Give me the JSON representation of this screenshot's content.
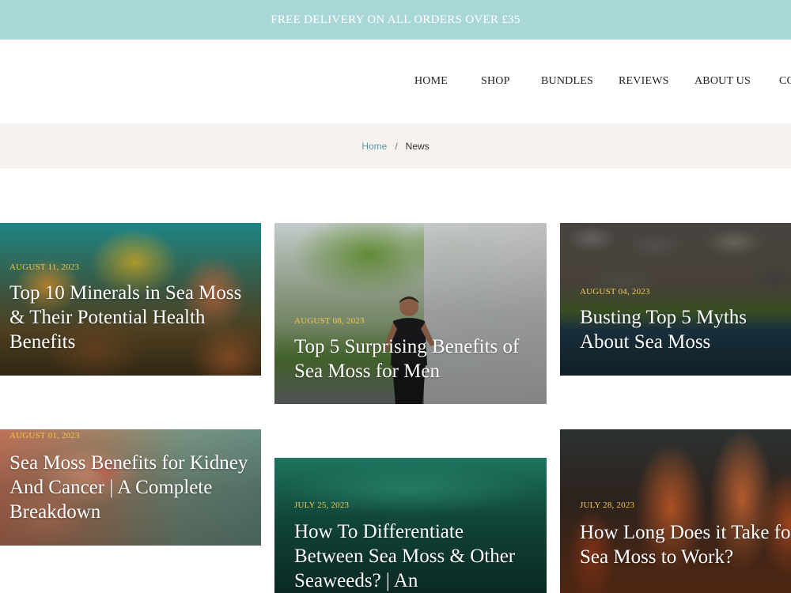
{
  "announcement": {
    "text": "FREE DELIVERY ON ALL ORDERS OVER £35"
  },
  "nav": {
    "items": [
      {
        "label": "HOME"
      },
      {
        "label": "SHOP"
      },
      {
        "label": "BUNDLES"
      },
      {
        "label": "REVIEWS"
      },
      {
        "label": "ABOUT US"
      },
      {
        "label": "CO"
      }
    ]
  },
  "breadcrumb": {
    "home": "Home",
    "separator": "/",
    "current": "News"
  },
  "articles": [
    {
      "date": "AUGUST 11, 2023",
      "title": "Top 10 Minerals in Sea Moss & Their Potential Health Benefits"
    },
    {
      "date": "AUGUST 08, 2023",
      "title": "Top 5 Surprising Benefits of Sea Moss for Men"
    },
    {
      "date": "AUGUST 04, 2023",
      "title": "Busting Top 5 Myths About Sea Moss"
    },
    {
      "date": "AUGUST 01, 2023",
      "title": "Sea Moss Benefits for Kidney And Cancer | A Complete Breakdown"
    },
    {
      "date": "JULY 25, 2023",
      "title": "How To Differentiate Between Sea Moss & Other Seaweeds? | An"
    },
    {
      "date": "JULY 28, 2023",
      "title": "How Long Does it Take for Sea Moss to Work?"
    }
  ],
  "colors": {
    "announcement_bg": "#a9d6d6",
    "breadcrumb_bg": "#f5f2ef",
    "breadcrumb_link": "#5a98a8",
    "date_accent": "#f3c84a"
  }
}
